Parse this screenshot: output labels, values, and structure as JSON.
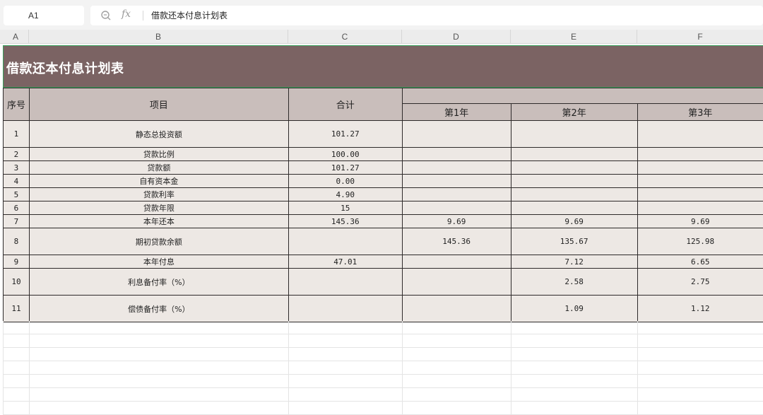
{
  "formula_bar": {
    "cell_ref": "A1",
    "zoom_icon": "zoom-icon",
    "fx_label": "fx",
    "content": "借款还本付息计划表"
  },
  "columns": [
    "A",
    "B",
    "C",
    "D",
    "E",
    "F"
  ],
  "sheet": {
    "title": "借款还本付息计划表",
    "headers": {
      "index": "序号",
      "item": "项目",
      "total": "合计",
      "years": [
        "第1年",
        "第2年",
        "第3年"
      ]
    },
    "rows": [
      {
        "no": "1",
        "item": "静态总投资额",
        "total": "101.27",
        "y1": "",
        "y2": "",
        "y3": ""
      },
      {
        "no": "2",
        "item": "贷款比例",
        "total": "100.00",
        "y1": "",
        "y2": "",
        "y3": ""
      },
      {
        "no": "3",
        "item": "贷款额",
        "total": "101.27",
        "y1": "",
        "y2": "",
        "y3": ""
      },
      {
        "no": "4",
        "item": "自有资本金",
        "total": "0.00",
        "y1": "",
        "y2": "",
        "y3": ""
      },
      {
        "no": "5",
        "item": "贷款利率",
        "total": "4.90",
        "y1": "",
        "y2": "",
        "y3": ""
      },
      {
        "no": "6",
        "item": "贷款年限",
        "total": "15",
        "y1": "",
        "y2": "",
        "y3": ""
      },
      {
        "no": "7",
        "item": "本年还本",
        "total": "145.36",
        "y1": "9.69",
        "y2": "9.69",
        "y3": "9.69"
      },
      {
        "no": "8",
        "item": "期初贷款余额",
        "total": "",
        "y1": "145.36",
        "y2": "135.67",
        "y3": "125.98"
      },
      {
        "no": "9",
        "item": "本年付息",
        "total": "47.01",
        "y1": "",
        "y2": "7.12",
        "y3": "6.65"
      },
      {
        "no": "10",
        "item": "利息备付率（%）",
        "total": "",
        "y1": "",
        "y2": "2.58",
        "y3": "2.75"
      },
      {
        "no": "11",
        "item": "偿债备付率（%）",
        "total": "",
        "y1": "",
        "y2": "1.09",
        "y3": "1.12"
      }
    ]
  },
  "colors": {
    "title_band": "#7b6363",
    "header_fill": "#c9bebb",
    "cell_fill": "#ede8e4",
    "selection": "#3aa15c"
  }
}
